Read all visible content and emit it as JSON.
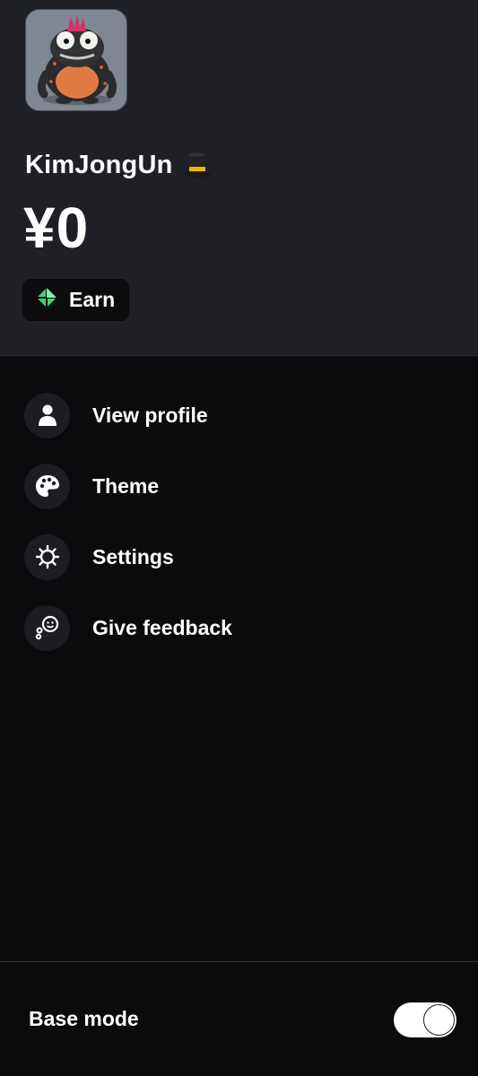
{
  "profile": {
    "username": "KimJongUn",
    "balance": "¥0"
  },
  "earn": {
    "label": "Earn",
    "icon": "diamond-icon"
  },
  "menu": [
    {
      "label": "View profile",
      "icon": "person-icon"
    },
    {
      "label": "Theme",
      "icon": "palette-icon"
    },
    {
      "label": "Settings",
      "icon": "gear-icon"
    },
    {
      "label": "Give feedback",
      "icon": "feedback-icon"
    }
  ],
  "footer": {
    "base_mode_label": "Base mode",
    "base_mode_on": true
  },
  "colors": {
    "header_bg": "#1f2026",
    "body_bg": "#0b0b0d",
    "earn_accent": "#3fd27a"
  }
}
